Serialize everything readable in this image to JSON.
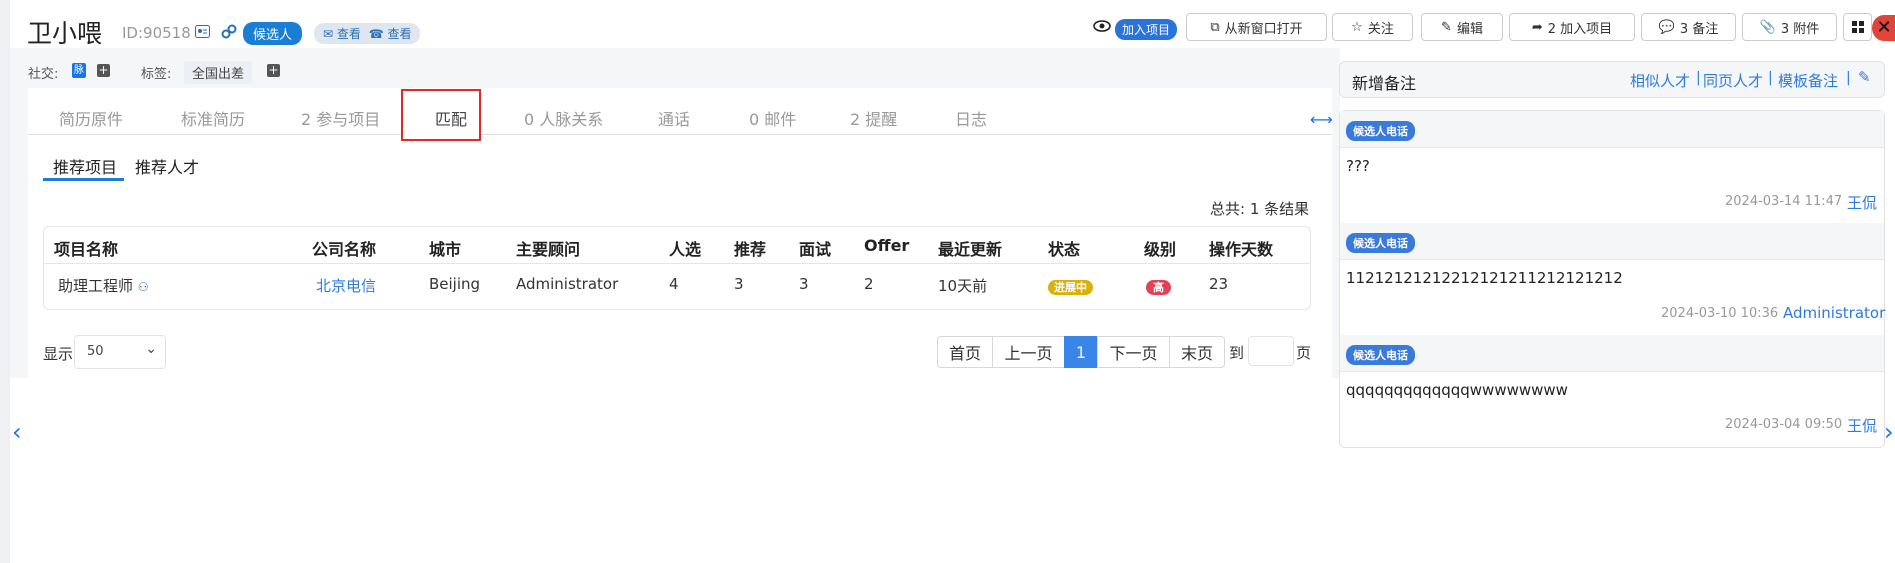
{
  "header": {
    "name": "卫小喂",
    "id": "ID:90518",
    "badge": "候选人",
    "contact_view1": "✉ 查看",
    "contact_view2": "☎ 查看",
    "join_badge": "加入项目",
    "btn_open_window": "从新窗口打开",
    "btn_follow": "关注",
    "btn_edit": "编辑",
    "btn_add_project": "2 加入项目",
    "btn_notes": "3 备注",
    "btn_attachments": "3 附件"
  },
  "profile": {
    "social_label": "社交:",
    "social_icon_text": "脉",
    "tags_label": "标签:",
    "tag": "全国出差"
  },
  "tabs": [
    {
      "label": "简历原件"
    },
    {
      "label": "标准简历"
    },
    {
      "label": "2 参与项目"
    },
    {
      "label": "匹配"
    },
    {
      "label": "0 人脉关系"
    },
    {
      "label": "通话"
    },
    {
      "label": "0 邮件"
    },
    {
      "label": "2 提醒"
    },
    {
      "label": "日志"
    }
  ],
  "subtabs": [
    {
      "label": "推荐项目"
    },
    {
      "label": "推荐人才"
    }
  ],
  "total_text": "总共: 1 条结果",
  "table": {
    "headers": [
      "项目名称",
      "公司名称",
      "城市",
      "主要顾问",
      "人选",
      "推荐",
      "面试",
      "Offer",
      "最近更新",
      "状态",
      "级别",
      "操作天数"
    ],
    "rows": [
      {
        "project": "助理工程师",
        "company": "北京电信",
        "city": "Beijing",
        "consultant": "Administrator",
        "candidates": "4",
        "recommend": "3",
        "interview": "3",
        "offer": "2",
        "updated": "10天前",
        "status": "进展中",
        "level": "高",
        "days": "23"
      }
    ]
  },
  "pagination": {
    "show_label": "显示",
    "page_size": "50",
    "first": "首页",
    "prev": "上一页",
    "current": "1",
    "next": "下一页",
    "last": "末页",
    "goto": "到",
    "page_suffix": "页"
  },
  "notes": {
    "title": "新增备注",
    "link_similar": "相似人才",
    "link_same_page": "同页人才",
    "link_template": "模板备注",
    "items": [
      {
        "badge": "候选人电话",
        "text": "???",
        "time": "2024-03-14 11:47",
        "user": "王侃"
      },
      {
        "badge": "候选人电话",
        "text": "11212121212212121211212121212",
        "time": "2024-03-10 10:36",
        "user": "Administrator"
      },
      {
        "badge": "候选人电话",
        "text": "qqqqqqqqqqqqqwwwwwwww",
        "time": "2024-03-04 09:50",
        "user": "王侃"
      }
    ]
  },
  "colors": {
    "accent": "#1a7fd4",
    "status": "#d9b10c",
    "level": "#e0425a",
    "highlight": "#e0282d"
  }
}
